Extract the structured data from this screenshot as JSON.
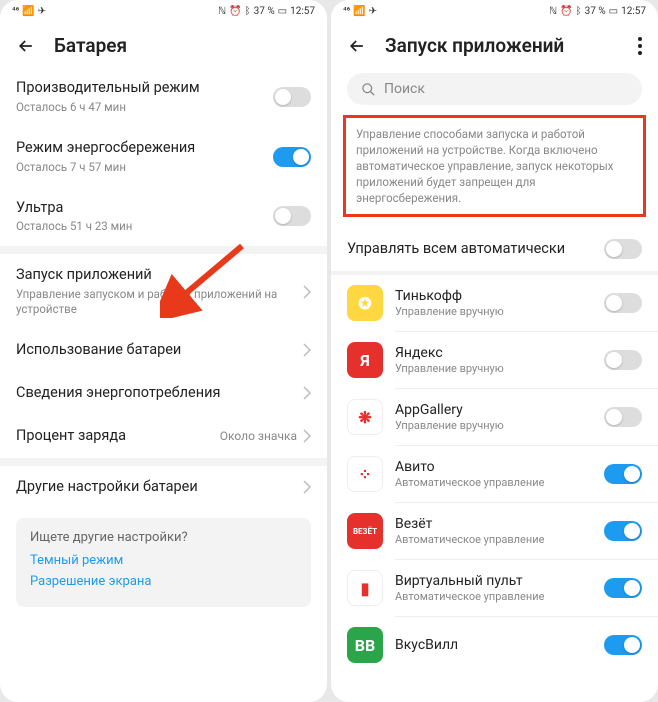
{
  "status": {
    "signal": "⁴⁶",
    "battery": "37 %",
    "time": "12:57"
  },
  "left": {
    "title": "Батарея",
    "perf": {
      "title": "Производительный режим",
      "sub": "Осталось 6 ч 47 мин"
    },
    "saver": {
      "title": "Режим энергосбережения",
      "sub": "Осталось 7 ч 57 мин"
    },
    "ultra": {
      "title": "Ультра",
      "sub": "Осталось 51 ч 23 мин"
    },
    "launch": {
      "title": "Запуск приложений",
      "sub": "Управление запуском и работой приложений на устройстве"
    },
    "usage": {
      "title": "Использование батареи"
    },
    "details": {
      "title": "Сведения энергопотребления"
    },
    "percent": {
      "title": "Процент заряда",
      "value": "Около значка"
    },
    "other": {
      "title": "Другие настройки батареи"
    },
    "tip": {
      "title": "Ищете другие настройки?",
      "link1": "Темный режим",
      "link2": "Разрешение экрана"
    }
  },
  "right": {
    "title": "Запуск приложений",
    "search_placeholder": "Поиск",
    "info": "Управление способами запуска и работой приложений на устройстве. Когда включено автоматическое управление, запуск некоторых приложений будет запрещен для энергосбережения.",
    "manage_all": "Управлять всем автоматически",
    "apps": [
      {
        "name": "Тинькофф",
        "sub": "Управление вручную",
        "on": false,
        "bg": "#ffd740",
        "char": "✪"
      },
      {
        "name": "Яндекс",
        "sub": "Управление вручную",
        "on": false,
        "bg": "#e5302c",
        "char": "Я"
      },
      {
        "name": "AppGallery",
        "sub": "Управление вручную",
        "on": false,
        "bg": "#fff",
        "char": "❋"
      },
      {
        "name": "Авито",
        "sub": "Автоматическое управление",
        "on": true,
        "bg": "#fff",
        "char": "⁘"
      },
      {
        "name": "Везёт",
        "sub": "Автоматическое управление",
        "on": true,
        "bg": "#e5302c",
        "char": "",
        "label": "ВЕЗЁТ"
      },
      {
        "name": "Виртуальный пульт",
        "sub": "Автоматическое управление",
        "on": true,
        "bg": "#fff",
        "char": "▮"
      },
      {
        "name": "ВкусВилл",
        "sub": "",
        "on": true,
        "bg": "#2aa54a",
        "char": "ВВ"
      }
    ]
  }
}
